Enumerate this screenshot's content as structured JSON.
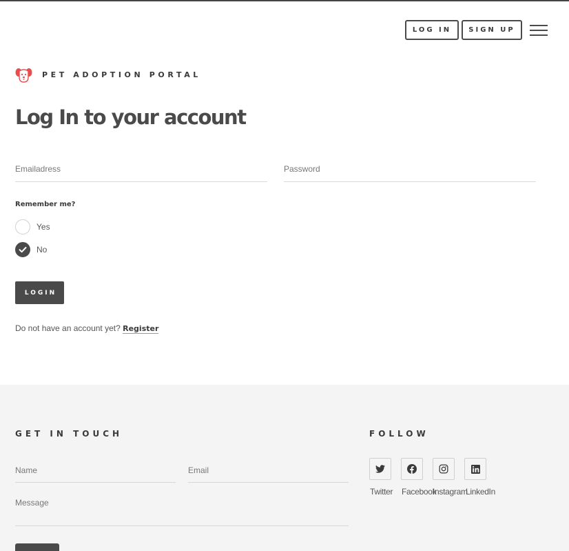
{
  "header": {
    "login_label": "LOG IN",
    "signup_label": "SIGN UP",
    "menu_icon": "hamburger-menu-icon"
  },
  "brand": {
    "name": "PET ADOPTION PORTAL",
    "logo_icon": "dog-face-icon",
    "logo_color": "#e84c4c"
  },
  "login_form": {
    "title": "Log In to your account",
    "email_placeholder": "Emailadress",
    "password_placeholder": "Password",
    "remember_label": "Remember me?",
    "options": [
      {
        "label": "Yes",
        "selected": false
      },
      {
        "label": "No",
        "selected": true
      }
    ],
    "submit_label": "LOGIN",
    "register_prompt": "Do not have an account yet?",
    "register_link": "Register"
  },
  "footer": {
    "contact_heading": "GET IN TOUCH",
    "name_placeholder": "Name",
    "email_placeholder": "Email",
    "message_placeholder": "Message",
    "follow_heading": "FOLLOW",
    "socials": [
      {
        "label": "Twitter",
        "icon": "twitter-icon"
      },
      {
        "label": "Facebook",
        "icon": "facebook-icon"
      },
      {
        "label": "Instagram",
        "icon": "instagram-icon"
      },
      {
        "label": "LinkedIn",
        "icon": "linkedin-icon"
      }
    ]
  },
  "colors": {
    "text_dark": "#4a4a4a",
    "footer_bg": "#f4f4f4",
    "button_bg": "#4a4a4a"
  }
}
